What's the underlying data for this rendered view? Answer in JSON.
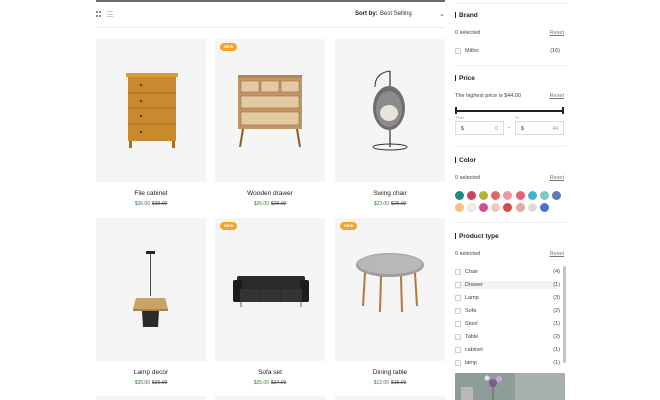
{
  "toolbar": {
    "sort_label": "Sort by:",
    "sort_value": "Best Selling"
  },
  "products": [
    {
      "title": "File cabinet",
      "price": "$36.00",
      "old_price": "$39.00",
      "badge": ""
    },
    {
      "title": "Wooden drawer",
      "price": "$26.00",
      "old_price": "$29.00",
      "badge": "NEW"
    },
    {
      "title": "Swing chair",
      "price": "$23.00",
      "old_price": "$25.00",
      "badge": ""
    },
    {
      "title": "Lamp decor",
      "price": "$35.00",
      "old_price": "$39.00",
      "badge": ""
    },
    {
      "title": "Sofa set",
      "price": "$25.00",
      "old_price": "$27.00",
      "badge": "NEW"
    },
    {
      "title": "Dining table",
      "price": "$12.00",
      "old_price": "$15.00",
      "badge": "NEW"
    }
  ],
  "filters": {
    "brand": {
      "title": "Brand",
      "selected": "0 selected",
      "reset": "Reset",
      "options": [
        {
          "label": "Mitho",
          "count": "(16)"
        }
      ]
    },
    "price": {
      "title": "Price",
      "note": "The highest price is $44.00",
      "reset": "Reset",
      "from_label": "From",
      "to_label": "To",
      "currency": "$",
      "from_value": "0",
      "to_value": "44",
      "range": [
        0,
        1
      ]
    },
    "color": {
      "title": "Color",
      "selected": "0 selected",
      "reset": "Reset",
      "swatches": [
        "#1f8a7a",
        "#c8475e",
        "#b5b23a",
        "#e06868",
        "#f09aa0",
        "#e8607a",
        "#3fb5c9",
        "#7fc8c6",
        "#5b7fb5",
        "#f4c27a",
        "#f6eedd",
        "#ce4f8c",
        "#f2c6c0",
        "#d64a4a",
        "#e8a8a0",
        "#d8d8d8",
        "#4a6fd6"
      ]
    },
    "product_type": {
      "title": "Product type",
      "selected": "0 selected",
      "reset": "Reset",
      "options": [
        {
          "label": "Chair",
          "count": "(4)"
        },
        {
          "label": "Drawer",
          "count": "(1)"
        },
        {
          "label": "Lamp",
          "count": "(3)"
        },
        {
          "label": "Sofa",
          "count": "(2)"
        },
        {
          "label": "Stool",
          "count": "(1)"
        },
        {
          "label": "Table",
          "count": "(2)"
        },
        {
          "label": "cabinet",
          "count": "(1)"
        },
        {
          "label": "lamp",
          "count": "(1)"
        }
      ]
    }
  },
  "colors": {
    "accent": "#f5a623",
    "sale_price": "#2e7d32",
    "card_bg": "#f5f5f5"
  },
  "icons": [
    "grid-view-icon",
    "list-view-icon",
    "chevron-down-icon"
  ]
}
